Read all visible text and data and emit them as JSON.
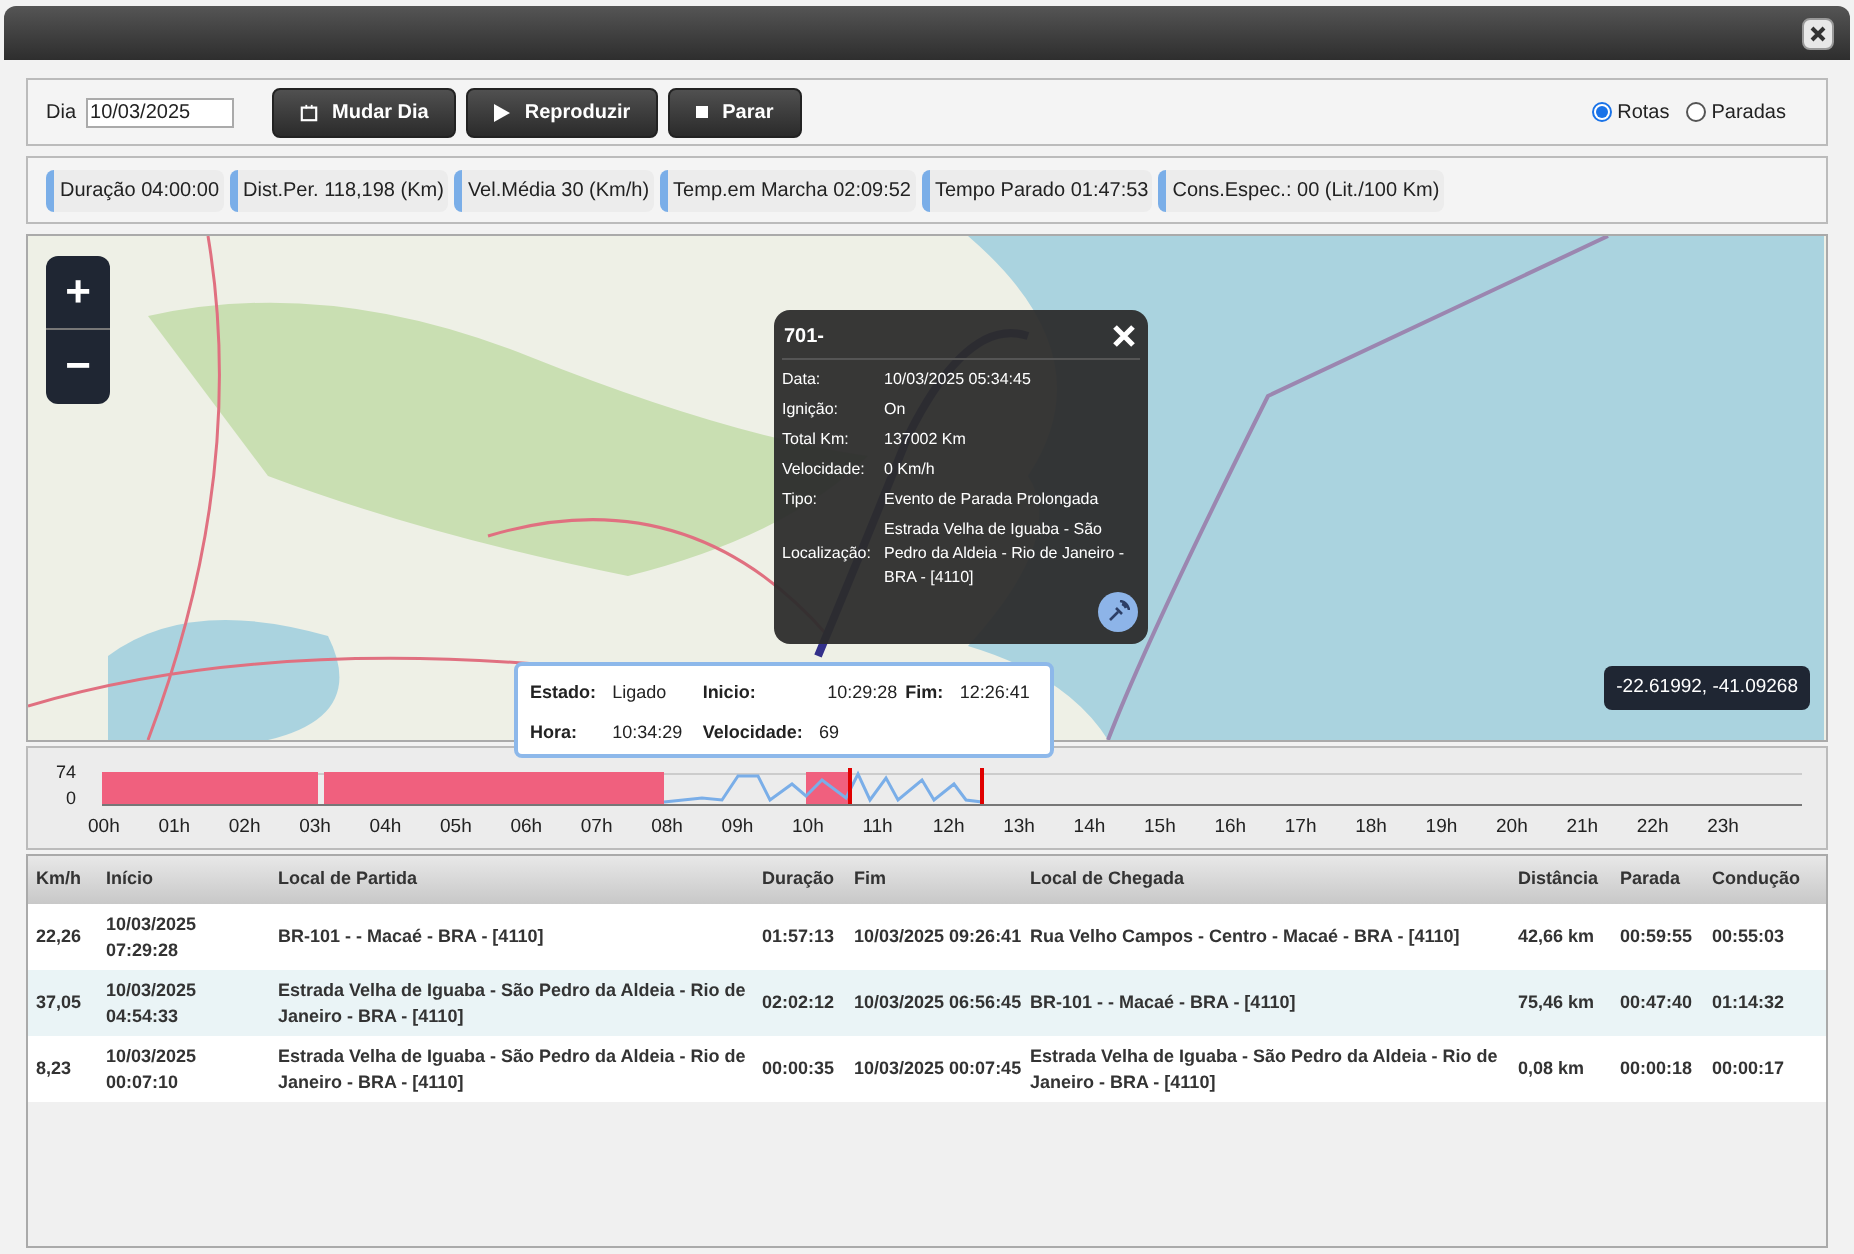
{
  "toolbar": {
    "day_label": "Dia",
    "day_value": "10/03/2025",
    "buttons": [
      {
        "kind": "calendar",
        "label": "Mudar Dia"
      },
      {
        "kind": "play",
        "label": "Reproduzir"
      },
      {
        "kind": "stop",
        "label": "Parar"
      }
    ],
    "views": [
      {
        "label": "Rotas",
        "selected": true
      },
      {
        "label": "Paradas",
        "selected": false
      }
    ]
  },
  "stats": [
    "Duração 04:00:00",
    "Dist.Per. 118,198 (Km)",
    "Vel.Média 30 (Km/h)",
    "Temp.em Marcha 02:09:52",
    "Tempo Parado 01:47:53",
    "Cons.Espec.: 00 (Lit./100 Km)"
  ],
  "map": {
    "zoom_in": "+",
    "zoom_out": "−",
    "coordinates": "-22.61992, -41.09268",
    "popup": {
      "title": "701-",
      "fields": [
        {
          "label": "Data:",
          "value": "10/03/2025 05:34:45"
        },
        {
          "label": "Ignição:",
          "value": "On"
        },
        {
          "label": "Total Km:",
          "value": "137002 Km"
        },
        {
          "label": "Velocidade:",
          "value": "0 Km/h"
        },
        {
          "label": "Tipo:",
          "value": "Evento de Parada Prolongada"
        },
        {
          "label": "Localização:",
          "value": "Estrada Velha de Iguaba - São Pedro da Aldeia - Rio de Janeiro - BRA - [4110]"
        }
      ]
    },
    "tooltip": {
      "estado_label": "Estado:",
      "estado": "Ligado",
      "inicio_label": "Inicio:",
      "inicio": "10:29:28",
      "fim_label": "Fim:",
      "fim": "12:26:41",
      "hora_label": "Hora:",
      "hora": "10:34:29",
      "velocidade_label": "Velocidade:",
      "velocidade": "69"
    }
  },
  "timeline": {
    "y_labels": [
      "74",
      "0"
    ],
    "hours": [
      "00h",
      "01h",
      "02h",
      "03h",
      "04h",
      "05h",
      "06h",
      "07h",
      "08h",
      "09h",
      "10h",
      "11h",
      "12h",
      "13h",
      "14h",
      "15h",
      "16h",
      "17h",
      "18h",
      "19h",
      "20h",
      "21h",
      "22h",
      "23h"
    ]
  },
  "table": {
    "columns": [
      "Km/h",
      "Início",
      "Local de Partida",
      "Duração",
      "Fim",
      "Local de Chegada",
      "Distância",
      "Parada",
      "Condução"
    ],
    "rows": [
      [
        "22,26",
        "10/03/2025 07:29:28",
        "BR-101 - - Macaé - BRA - [4110]",
        "01:57:13",
        "10/03/2025 09:26:41",
        "Rua Velho Campos - Centro - Macaé - BRA - [4110]",
        "42,66 km",
        "00:59:55",
        "00:55:03"
      ],
      [
        "37,05",
        "10/03/2025 04:54:33",
        "Estrada Velha de Iguaba - São Pedro da Aldeia - Rio de Janeiro - BRA - [4110]",
        "02:02:12",
        "10/03/2025 06:56:45",
        "BR-101 - - Macaé - BRA - [4110]",
        "75,46 km",
        "00:47:40",
        "01:14:32"
      ],
      [
        "8,23",
        "10/03/2025 00:07:10",
        "Estrada Velha de Iguaba - São Pedro da Aldeia - Rio de Janeiro - BRA - [4110]",
        "00:00:35",
        "10/03/2025 00:07:45",
        "Estrada Velha de Iguaba - São Pedro da Aldeia - Rio de Janeiro - BRA - [4110]",
        "0,08 km",
        "00:00:18",
        "00:00:17"
      ]
    ]
  }
}
